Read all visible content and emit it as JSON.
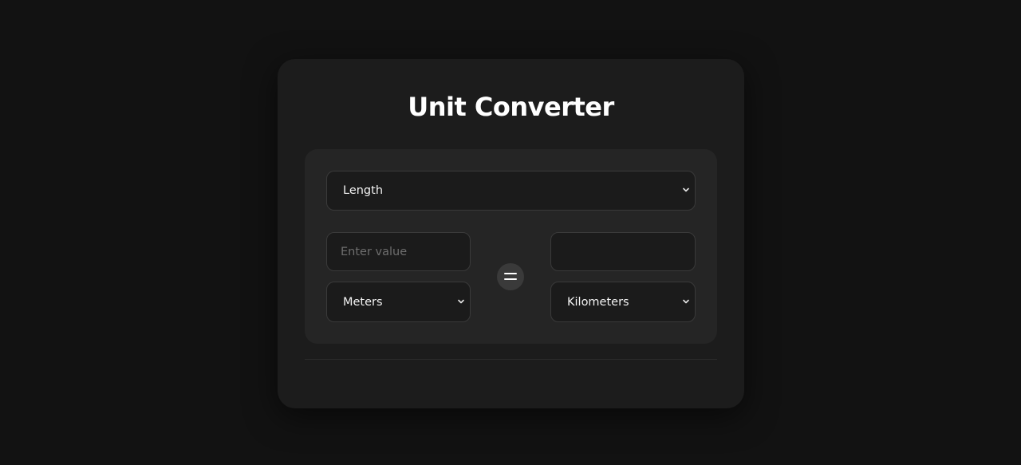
{
  "app": {
    "title": "Unit Converter"
  },
  "converter": {
    "category": {
      "selected": "Length"
    },
    "from": {
      "value": "",
      "placeholder": "Enter value",
      "unit": "Meters"
    },
    "to": {
      "value": "",
      "unit": "Kilometers"
    },
    "equals_icon": "equals-icon"
  },
  "colors": {
    "background": "#121212",
    "card": "#1c1c1c",
    "panel": "#252525",
    "field": "#1b1b1b",
    "field_border": "#3a3a3a",
    "text": "#ffffff",
    "placeholder": "#6e6e6e",
    "equals_circle": "#3a3a3a"
  }
}
